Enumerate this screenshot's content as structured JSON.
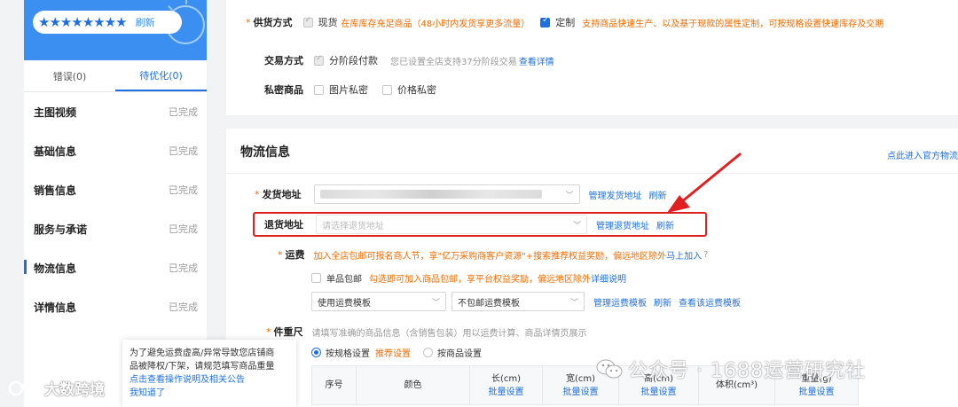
{
  "sidebar": {
    "stars": "★★★★★★★★",
    "refresh": "刷新",
    "tabs": [
      {
        "label": "错误(0)"
      },
      {
        "label": "待优化(0)"
      }
    ],
    "items": [
      {
        "label": "主图视频",
        "status": "已完成"
      },
      {
        "label": "基础信息",
        "status": "已完成"
      },
      {
        "label": "销售信息",
        "status": "已完成"
      },
      {
        "label": "服务与承诺",
        "status": "已完成"
      },
      {
        "label": "物流信息",
        "status": "已完成"
      },
      {
        "label": "详情信息",
        "status": "已完成"
      }
    ]
  },
  "supply": {
    "label": "供货方式",
    "opt1": "现货",
    "opt1_note": "在库库存充足商品（48小时内发货享更多流量）",
    "opt2": "定制",
    "opt2_note": "支持商品快速生产、以及基于现款的属性定制，可按规格设置快速库存及交期"
  },
  "trade": {
    "label": "交易方式",
    "opt": "分阶段付款",
    "note": "您已设置全店支持37分阶段交易",
    "link": "查看详情"
  },
  "private": {
    "label": "私密商品",
    "opt1": "图片私密",
    "opt2": "价格私密"
  },
  "logistics": {
    "title": "物流信息",
    "top_link": "点此进入官方物流",
    "ship": {
      "label": "发货地址",
      "manage": "管理发货地址",
      "refresh": "刷新"
    },
    "return": {
      "label": "退货地址",
      "placeholder": "请选择退货地址",
      "manage": "管理退货地址",
      "refresh": "刷新"
    },
    "freight": {
      "label": "运费",
      "note": "加入全店包邮可报名商人节，享\"亿万采购商客户资源\"+搜索推荐权益奖励，偏远地区除外",
      "join": "马上加入",
      "single": "单品包邮",
      "single_note": "勾选即可加入商品包邮，享平台权益奖励，偏远地区除外",
      "detail": "详细说明",
      "tpl1": "使用运费模板",
      "tpl2": "不包邮运费模板",
      "manage": "管理运费模板",
      "refresh": "刷新",
      "view": "查看该运费模板"
    },
    "size": {
      "label": "件重尺",
      "note": "请填写准确的商品信息（含销售包装）用以运费计算、商品详情页展示",
      "radio1": "按规格设置",
      "recommend": "推荐设置",
      "radio2": "按商品设置"
    },
    "table": {
      "headers": [
        "序号",
        "颜色",
        "长(cm)",
        "宽(cm)",
        "高(cm)",
        "体积(cm³)",
        "重量(g)"
      ],
      "batch": "批量设置"
    }
  },
  "popup": {
    "line1": "为了避免运费虚高/异常导致您店铺商",
    "line2": "品被降权/下架，请规范填写商品重量",
    "link": "点击查看操作说明及相关公告",
    "ok": "我知道了"
  },
  "watermark": {
    "left": "大数跨境",
    "right": "公众号 · 1688运营研究社"
  }
}
